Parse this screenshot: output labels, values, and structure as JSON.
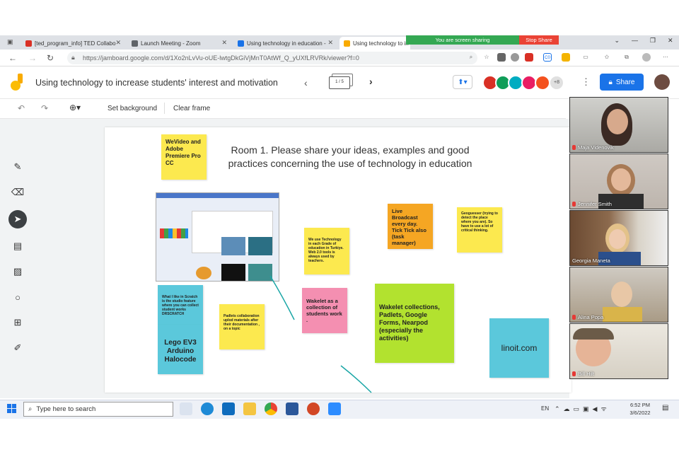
{
  "browser": {
    "tabs": [
      {
        "label": "[ted_program_info] TED Collabo",
        "favicon_color": "#d93025"
      },
      {
        "label": "Launch Meeting - Zoom",
        "favicon_color": "#5f6368"
      },
      {
        "label": "Using technology in education -",
        "favicon_color": "#1a73e8"
      },
      {
        "label": "Using technology to in",
        "favicon_color": "#f9ab00"
      }
    ],
    "screen_sharing_text": "You are screen sharing",
    "stop_share_label": "Stop Share",
    "url": "https://jamboard.google.com/d/1Xo2nLvVu-oUE-lwtgDkGiVjMnT0AtWf_Q_yUXfLRVRk/viewer?f=0"
  },
  "jamboard": {
    "title": "Using technology to increase students' interest and motivation",
    "frame_indicator": "1 / 5",
    "collaborator_count": "+8",
    "share_label": "Share",
    "toolbar": {
      "set_background": "Set background",
      "clear_frame": "Clear frame"
    },
    "heading": "Room 1. Please share your ideas, examples and good practices concerning the use of technology in education",
    "notes": [
      {
        "text": "WeVideo and Adobe Premiere Pro CC",
        "color": "#fce94f"
      },
      {
        "text": "Live Broadcast every day. Tick Tick also (task manager)",
        "color": "#f5a623"
      },
      {
        "text": "Geoguesser (trying to detect the place where you are). So have to use a lot of critical thinking.",
        "color": "#fce94f"
      },
      {
        "text": "We use Technology in each Grade of education in Turkiye. Web 2.0 tools is always used by teachers.",
        "color": "#fce94f"
      },
      {
        "text": "Wakelet as a collection of students work .",
        "color": "#f48fb1"
      },
      {
        "text": "Wakelet collections, Padlets, Google Forms, Nearpod (especially the activities)",
        "color": "#b2e22f"
      },
      {
        "text": "What I like in Scratch is the studio feature where you can collect student works DRSCRATCH",
        "color": "#5bc8db"
      },
      {
        "text": "Padlets collaboration uplod materials after their documentation , on a topic",
        "color": "#fce94f"
      },
      {
        "text": "Lego EV3 Arduino Halocode",
        "color": "#5bc8db"
      },
      {
        "text": "linoit.com",
        "color": "#5bc8db"
      }
    ]
  },
  "participants": [
    {
      "name": "Maja Videnovik"
    },
    {
      "name": "Jennifer Smith"
    },
    {
      "name": "Georgia Maneta"
    },
    {
      "name": "Alina Popa"
    },
    {
      "name": "Bill Hilt"
    }
  ],
  "taskbar": {
    "search_placeholder": "Type here to search",
    "language": "EN",
    "time": "6:52 PM",
    "date": "3/6/2022"
  }
}
